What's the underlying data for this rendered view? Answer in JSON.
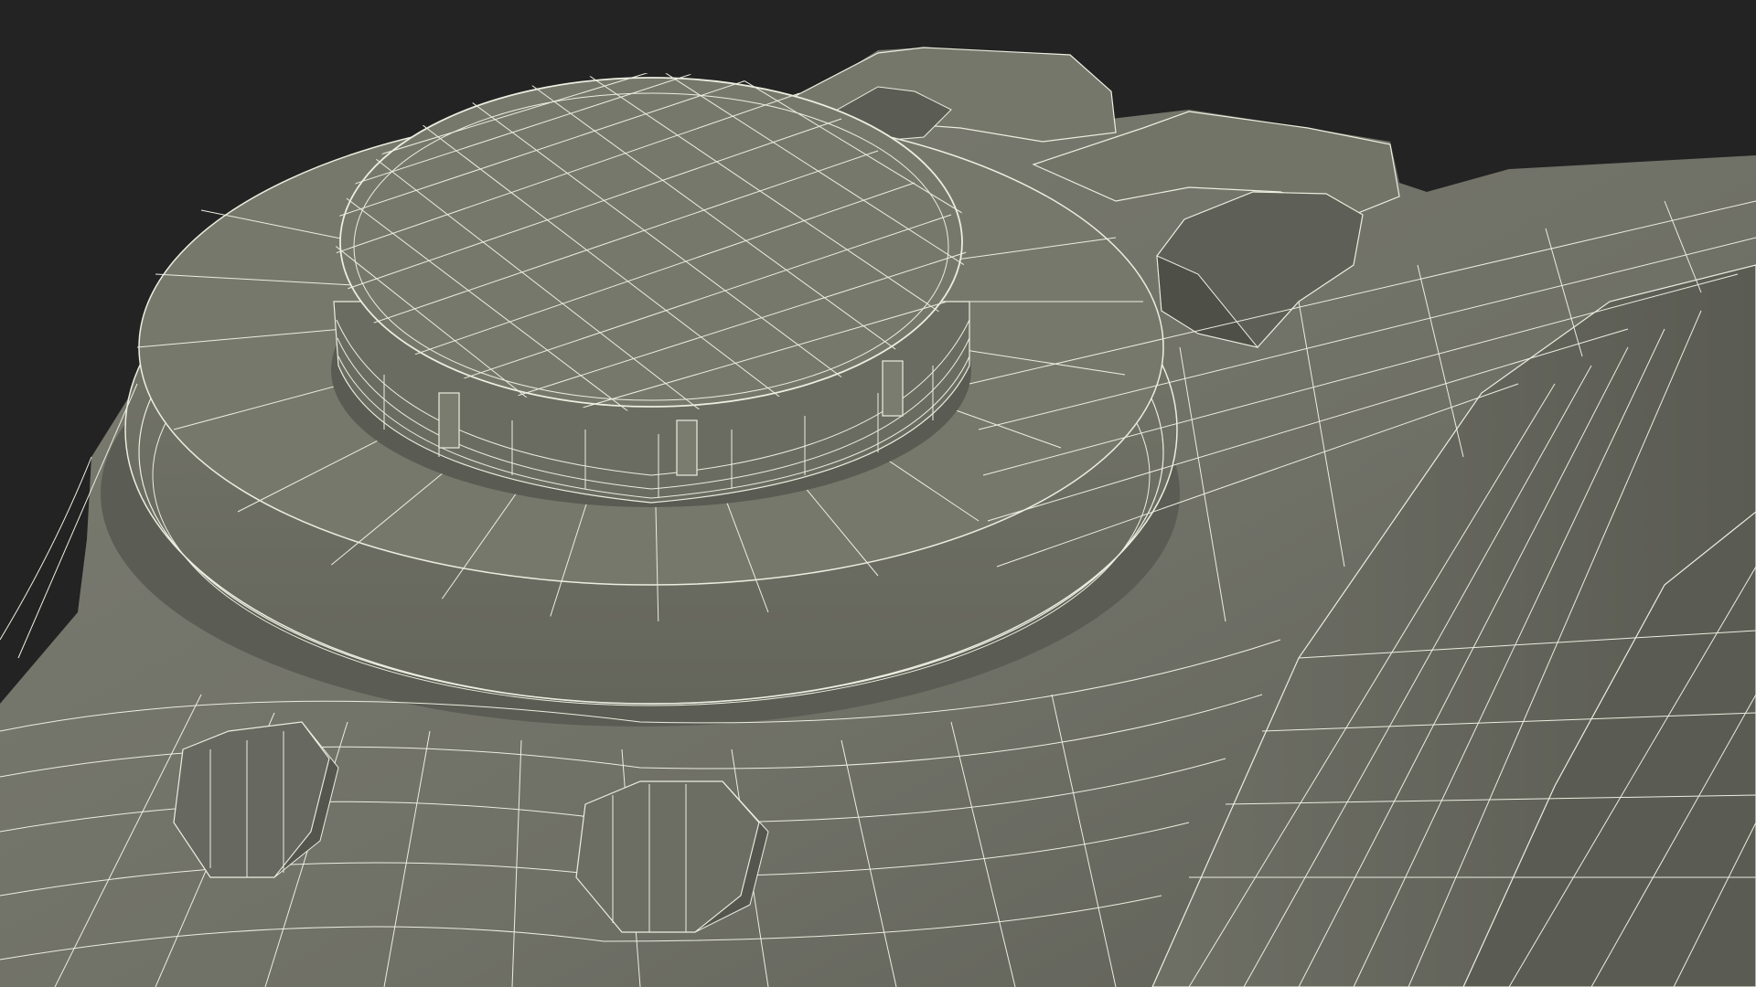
{
  "render": {
    "background": "#232323",
    "surface_light": "#7b7c70",
    "surface_mid": "#6d6e63",
    "surface_dark": "#56574e",
    "surface_shadow": "#45463f",
    "wire_color": "#eceee0"
  },
  "icons": []
}
